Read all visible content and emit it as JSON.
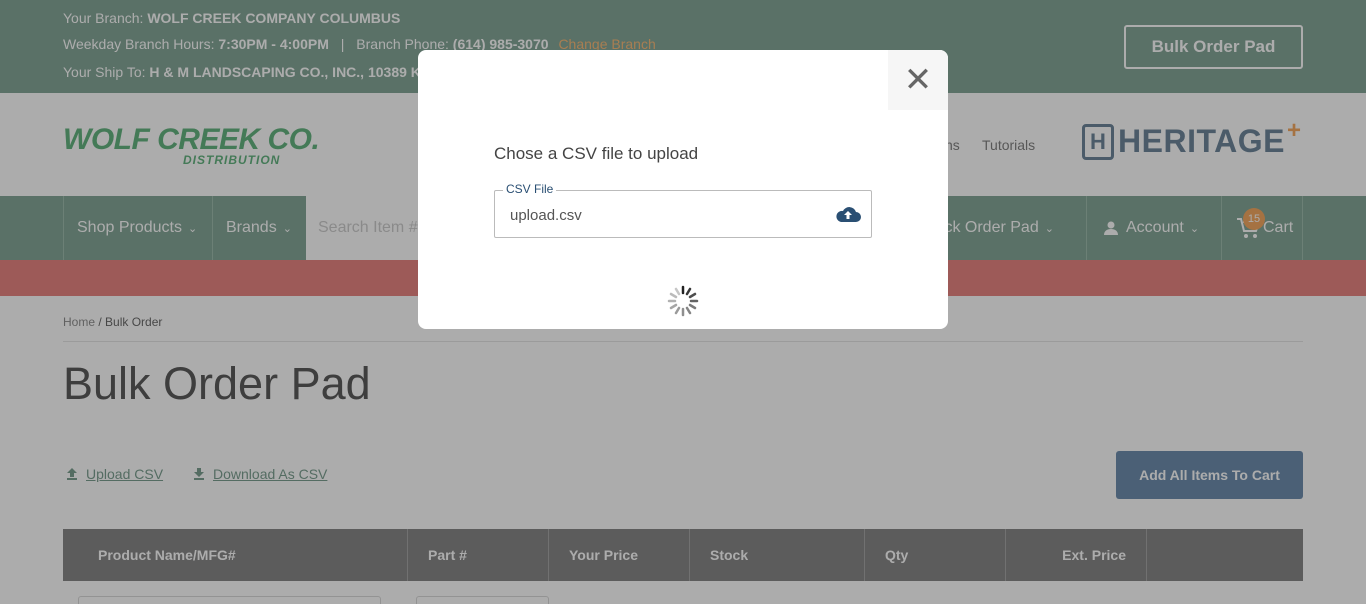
{
  "topbar": {
    "branch_label": "Your Branch:",
    "branch_name": "WOLF CREEK COMPANY COLUMBUS",
    "hours_label": "Weekday Branch Hours:",
    "hours_value": "7:30PM - 4:00PM",
    "separator": "|",
    "phone_label": "Branch Phone:",
    "phone_value": "(614) 985-3070",
    "change_branch": "Change Branch",
    "shipto_label": "Your Ship To:",
    "shipto_value": "H & M LANDSCAPING CO., INC., 10389 K",
    "bulk_order_pad_btn": "Bulk Order Pad"
  },
  "logo": {
    "wolf_creek": "WOLF CREEK CO.",
    "distribution": "DISTRIBUTION",
    "heritage": "HERITAGE",
    "heritage_h": "H",
    "heritage_plus": "+"
  },
  "header_links": {
    "partial": "ns",
    "tutorials": "Tutorials"
  },
  "nav": {
    "shop_products": "Shop Products",
    "brands": "Brands",
    "search_placeholder": "Search Item #",
    "quick_order_pad": "uick Order Pad",
    "account": "Account",
    "cart": "Cart",
    "cart_count": "15"
  },
  "breadcrumb": {
    "home": "Home",
    "separator": "/",
    "current": "Bulk Order"
  },
  "page": {
    "title": "Bulk Order Pad",
    "upload_csv": "Upload CSV",
    "download_csv": "Download As CSV",
    "add_all": "Add All Items To Cart"
  },
  "table": {
    "columns": [
      "Product Name/MFG#",
      "Part #",
      "Your Price",
      "Stock",
      "Qty",
      "Ext. Price",
      ""
    ]
  },
  "modal": {
    "title": "Chose a CSV file to upload",
    "field_label": "CSV File",
    "field_value": "upload.csv",
    "close_glyph": "✕"
  },
  "colors": {
    "brand_green": "#5a8874",
    "accent_orange": "#f08a2a",
    "button_blue": "#3c6793",
    "alert_red": "#e05b56"
  },
  "icons": [
    "close-icon",
    "cloud-upload-icon",
    "loading-spinner-icon",
    "user-icon",
    "cart-icon",
    "chevron-down-icon",
    "upload-icon",
    "download-icon"
  ]
}
